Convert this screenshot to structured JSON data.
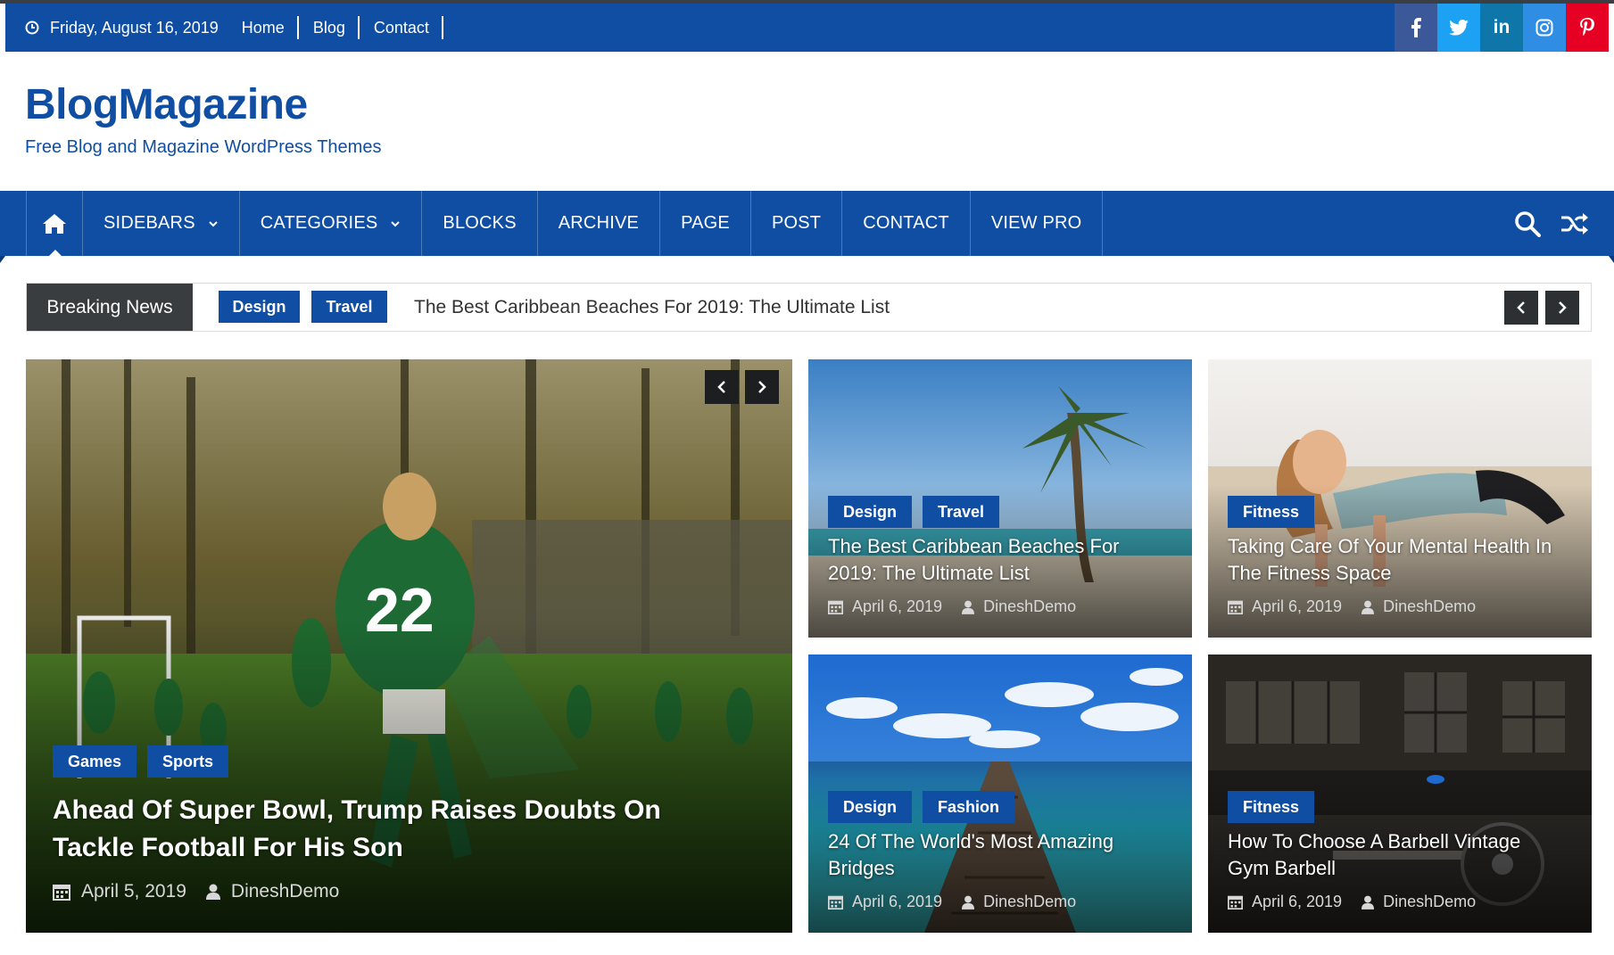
{
  "colors": {
    "brand": "#0f4ea3",
    "dark": "#3a3d40",
    "facebook": "#3b5998",
    "twitter": "#1da1f2",
    "linkedin": "#0e76a8",
    "instagram": "#2f8de4",
    "pinterest": "#e60023"
  },
  "topbar": {
    "date": "Friday, August 16, 2019",
    "links": [
      "Home",
      "Blog",
      "Contact"
    ],
    "social": [
      "facebook-icon",
      "twitter-icon",
      "linkedin-icon",
      "instagram-icon",
      "pinterest-icon"
    ]
  },
  "site": {
    "title": "BlogMagazine",
    "tagline": "Free Blog and Magazine WordPress Themes"
  },
  "nav": {
    "items": [
      "SIDEBARS",
      "CATEGORIES",
      "BLOCKS",
      "ARCHIVE",
      "PAGE",
      "POST",
      "CONTACT",
      "VIEW PRO"
    ],
    "dropdown_items": [
      "SIDEBARS",
      "CATEGORIES"
    ]
  },
  "breaking": {
    "label": "Breaking News",
    "tags": [
      "Design",
      "Travel"
    ],
    "headline": "The Best Caribbean Beaches For 2019: The Ultimate List"
  },
  "featured": {
    "categories": [
      "Games",
      "Sports"
    ],
    "title": "Ahead Of Super Bowl, Trump Raises Doubts On Tackle Football For His Son",
    "date": "April 5, 2019",
    "author": "DineshDemo"
  },
  "cards": [
    {
      "categories": [
        "Design",
        "Travel"
      ],
      "title": "The Best Caribbean Beaches For 2019: The Ultimate List",
      "date": "April 6, 2019",
      "author": "DineshDemo"
    },
    {
      "categories": [
        "Fitness"
      ],
      "title": "Taking Care Of Your Mental Health In The Fitness Space",
      "date": "April 6, 2019",
      "author": "DineshDemo"
    },
    {
      "categories": [
        "Design",
        "Fashion"
      ],
      "title": "24 Of The World's Most Amazing Bridges",
      "date": "April 6, 2019",
      "author": "DineshDemo"
    },
    {
      "categories": [
        "Fitness"
      ],
      "title": "How To Choose A Barbell Vintage Gym Barbell",
      "date": "April 6, 2019",
      "author": "DineshDemo"
    }
  ]
}
